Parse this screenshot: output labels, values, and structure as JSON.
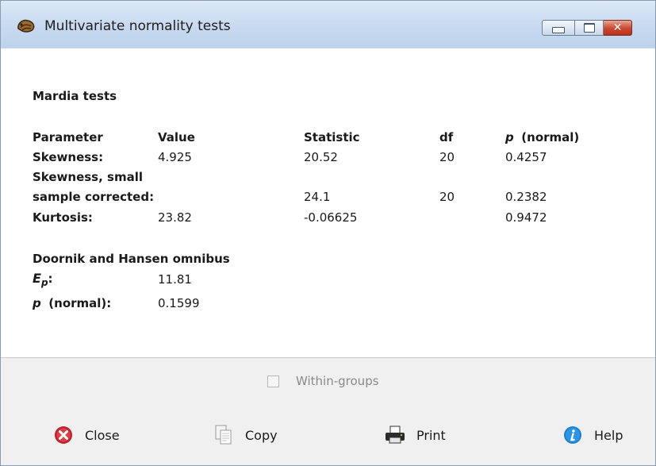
{
  "window": {
    "title": "Multivariate normality tests",
    "close_glyph": "✕",
    "icons": [
      "app-icon",
      "minimize-icon",
      "maximize-icon",
      "close-icon"
    ]
  },
  "results": {
    "mardia_heading": "Mardia tests",
    "headers": {
      "parameter": "Parameter",
      "value": "Value",
      "statistic": "Statistic",
      "df": "df",
      "p_symbol": "p",
      "p_suffix": "(normal)"
    },
    "skewness": {
      "label": "Skewness:",
      "value": "4.925",
      "statistic": "20.52",
      "df": "20",
      "p": "0.4257"
    },
    "skewness_small": {
      "label_line1": "Skewness, small",
      "label_line2": "sample corrected:",
      "statistic": "24.1",
      "df": "20",
      "p": "0.2382"
    },
    "kurtosis": {
      "label": "Kurtosis:",
      "value": "23.82",
      "statistic": "-0.06625",
      "p": "0.9472"
    },
    "omnibus_heading": "Doornik and Hansen omnibus",
    "ep": {
      "symbol": "E",
      "subscript": "p",
      "colon": ":",
      "value": "11.81"
    },
    "p_normal": {
      "symbol": "p",
      "suffix": "(normal):",
      "value": "0.1599"
    }
  },
  "within_groups": {
    "label": "Within-groups",
    "checked": false
  },
  "footer": {
    "close": "Close",
    "copy": "Copy",
    "print": "Print",
    "help": "Help",
    "icons": [
      "close-circle-icon",
      "copy-icon",
      "printer-icon",
      "info-icon"
    ]
  },
  "colors": {
    "titlebar": "#c5d8ef",
    "close_button": "#c9462e",
    "panel_gray": "#f0f0f0",
    "help_blue": "#1e7fd0",
    "close_red": "#c4202a"
  }
}
